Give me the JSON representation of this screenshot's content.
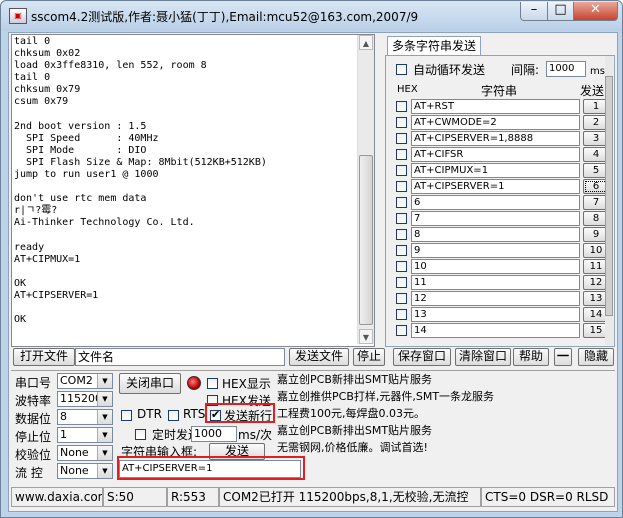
{
  "window": {
    "title": "sscom4.2测试版,作者:聂小猛(丁丁),Email:mcu52@163.com,2007/9",
    "min_label": "–",
    "max_label": "□",
    "close_label": "✕"
  },
  "receive_text": "tail 0\nchksum 0x02\nload 0x3ffe8310, len 552, room 8\ntail 0\nchksum 0x79\ncsum 0x79\n\n2nd boot version : 1.5\n  SPI Speed      : 40MHz\n  SPI Mode       : DIO\n  SPI Flash Size & Map: 8Mbit(512KB+512KB)\njump to run user1 @ 1000\n\ndon't use rtc mem data\nr|ㄱ?霉?\nAi-Thinker Technology Co. Ltd.\n\nready\nAT+CIPMUX=1\n\nOK\nAT+CIPSERVER=1\n\nOK",
  "multi": {
    "tab_label": "多条字符串发送",
    "auto_loop_label": "自动循环发送",
    "interval_label": "间隔:",
    "interval_value": "1000",
    "interval_unit": "ms",
    "col_hex": "HEX",
    "col_string": "字符串",
    "col_send": "发送",
    "rows": [
      {
        "text": "AT+RST",
        "num": "1"
      },
      {
        "text": "AT+CWMODE=2",
        "num": "2"
      },
      {
        "text": "AT+CIPSERVER=1,8888",
        "num": "3"
      },
      {
        "text": "AT+CIFSR",
        "num": "4"
      },
      {
        "text": "AT+CIPMUX=1",
        "num": "5"
      },
      {
        "text": "AT+CIPSERVER=1",
        "num": "6"
      },
      {
        "text": "6",
        "num": "7"
      },
      {
        "text": "7",
        "num": "8"
      },
      {
        "text": "8",
        "num": "9"
      },
      {
        "text": "9",
        "num": "10"
      },
      {
        "text": "10",
        "num": "11"
      },
      {
        "text": "11",
        "num": "12"
      },
      {
        "text": "12",
        "num": "13"
      },
      {
        "text": "13",
        "num": "14"
      },
      {
        "text": "14",
        "num": "15"
      }
    ]
  },
  "toolbar": {
    "open_file": "打开文件",
    "file_name": "文件名",
    "send_file": "发送文件",
    "stop": "停止",
    "save_window": "保存窗口",
    "clear_window": "清除窗口",
    "help": "帮助",
    "dash": "一",
    "hide": "隐藏"
  },
  "settings": {
    "port_label": "串口号",
    "port_value": "COM2",
    "baud_label": "波特率",
    "baud_value": "115200",
    "data_label": "数据位",
    "data_value": "8",
    "stop_label": "停止位",
    "stop_value": "1",
    "parity_label": "校验位",
    "parity_value": "None",
    "flow_label": "流 控",
    "flow_value": "None",
    "close_port": "关闭串口",
    "hex_show": "HEX显示",
    "hex_send": "HEX发送",
    "dtr": "DTR",
    "rts": "RTS",
    "send_newline": "发送新行",
    "timed_send": "定时发送",
    "timed_value": "1000",
    "timed_unit": "ms/次",
    "input_label": "字符串输入框:",
    "send_button": "发送",
    "input_value": "AT+CIPSERVER=1"
  },
  "ad_lines": [
    "嘉立创PCB新排出SMT贴片服务",
    "嘉立创推供PCB打样,元器件,SMT一条龙服务",
    "工程费100元,每焊盘0.03元。",
    "嘉立创PCB新排出SMT贴片服务",
    "无需钢网,价格低廉。调试首选!"
  ],
  "status": {
    "site": "www.daxia.com",
    "sent": "S:50",
    "received": "R:553",
    "port_state": "COM2已打开  115200bps,8,1,无校验,无流控",
    "lines": "CTS=0 DSR=0 RLSD"
  }
}
